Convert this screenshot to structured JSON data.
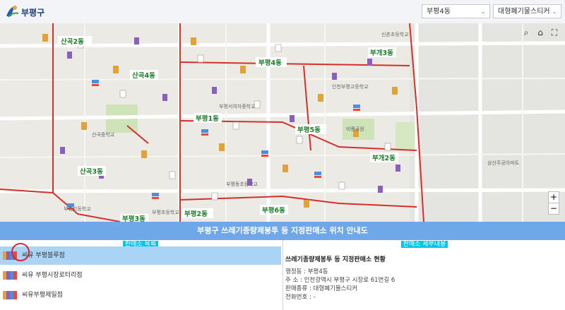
{
  "header": {
    "brand": "부평구",
    "dong_select": "부평4동",
    "type_select": "대형폐기물스티커"
  },
  "map": {
    "district_labels": [
      "산곡2동",
      "산곡4동",
      "부평4동",
      "부개3동",
      "부평1동",
      "부평5동",
      "산곡3동",
      "부개2동",
      "부평2동",
      "부평6동",
      "부평3동"
    ],
    "place_labels": [
      "신촌초등학교",
      "부평서여자중학교",
      "부평동초등학교",
      "부평고등학교",
      "비룡공원",
      "부평초등학교",
      "인천부평고등학교",
      "산곡중학교",
      "삼산주공아파트"
    ],
    "colors": {
      "boundary": "#d2302c",
      "road": "#ffffff",
      "park": "#cfe3b8",
      "label_bg": "#ffffff",
      "label_text": "#1d7f2a"
    }
  },
  "banner": "부평구 쓰레기종량제봉투 등 지정판매소 위치 안내도",
  "left_panel": {
    "title": "판매소 목록",
    "items": [
      {
        "label": "씨유 부평블루점",
        "selected": true
      },
      {
        "label": "씨유 부평시장로터리점",
        "selected": false
      },
      {
        "label": "씨유부평제일점",
        "selected": false
      }
    ]
  },
  "right_panel": {
    "title": "판매소 세부내용",
    "heading": "쓰레기종량제봉투 등 지정판매소 현황",
    "lines": [
      "행정동 : 부평4동",
      "주 소 : 인천광역시 부평구 시장로 61번길 6",
      "판매종류 : 대형폐기물스티커",
      "전화번호 : -"
    ]
  },
  "icons": [
    "logo-icon",
    "search-icon",
    "home-icon",
    "fullscreen-icon",
    "zoom-in-icon",
    "zoom-out-icon",
    "store-icon",
    "chevron-down-icon"
  ]
}
